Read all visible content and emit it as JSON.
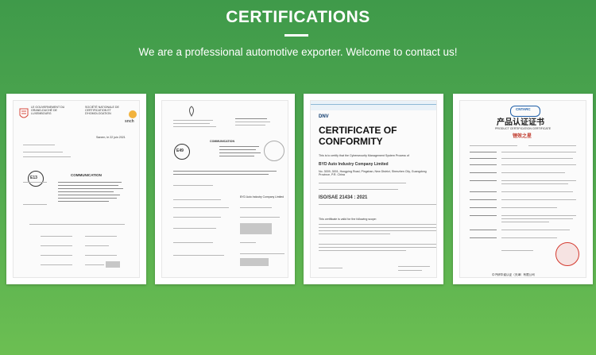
{
  "header": {
    "title": "CERTIFICATIONS",
    "subtitle": "We are a professional automotive exporter. Welcome to contact us!"
  },
  "cert1": {
    "org_left": "LE GOUVERNEMENT DU GRAND-DUCHÉ DE LUXEMBOURG",
    "org_right": "SOCIÉTÉ NATIONALE DE CERTIFICATION ET D'HOMOLOGATION",
    "logo_text": "snch",
    "e_mark": "E13",
    "heading": "COMMUNICATION",
    "date": "Sanem, le 22 juin 2021"
  },
  "cert2": {
    "mark": "E49",
    "heading": "COMMUNICATION",
    "manufacturer": "BYD Auto Industry Company Limited"
  },
  "cert3": {
    "dnv": "DNV",
    "title_line1": "CERTIFICATE OF",
    "title_line2": "CONFORMITY",
    "certify": "This is to certify that the Cybersecurity Management System Process of",
    "company": "BYD Auto Industry Company Limited",
    "address": "No. 3009, 3001, Hongping Road, Pingshan, New District, Shenzhen City, Guangdong Province, P.R. China",
    "standard": "ISO/SAE 21434 : 2021",
    "scope_label": "This certificate is valid for the following scope:"
  },
  "cert4": {
    "logo": "CNTARC",
    "title_cn": "产品认证证书",
    "title_en": "PRODUCT CERTIFICATION CERTIFICATE",
    "subtitle_cn": "锂效之星",
    "footer_cn": "中汽研华诚认证（天津）有限公司"
  },
  "colors": {
    "accent_green": "#4fa84f",
    "dnv_blue": "#0f3b6e",
    "stamp_red": "#d43a2f"
  }
}
